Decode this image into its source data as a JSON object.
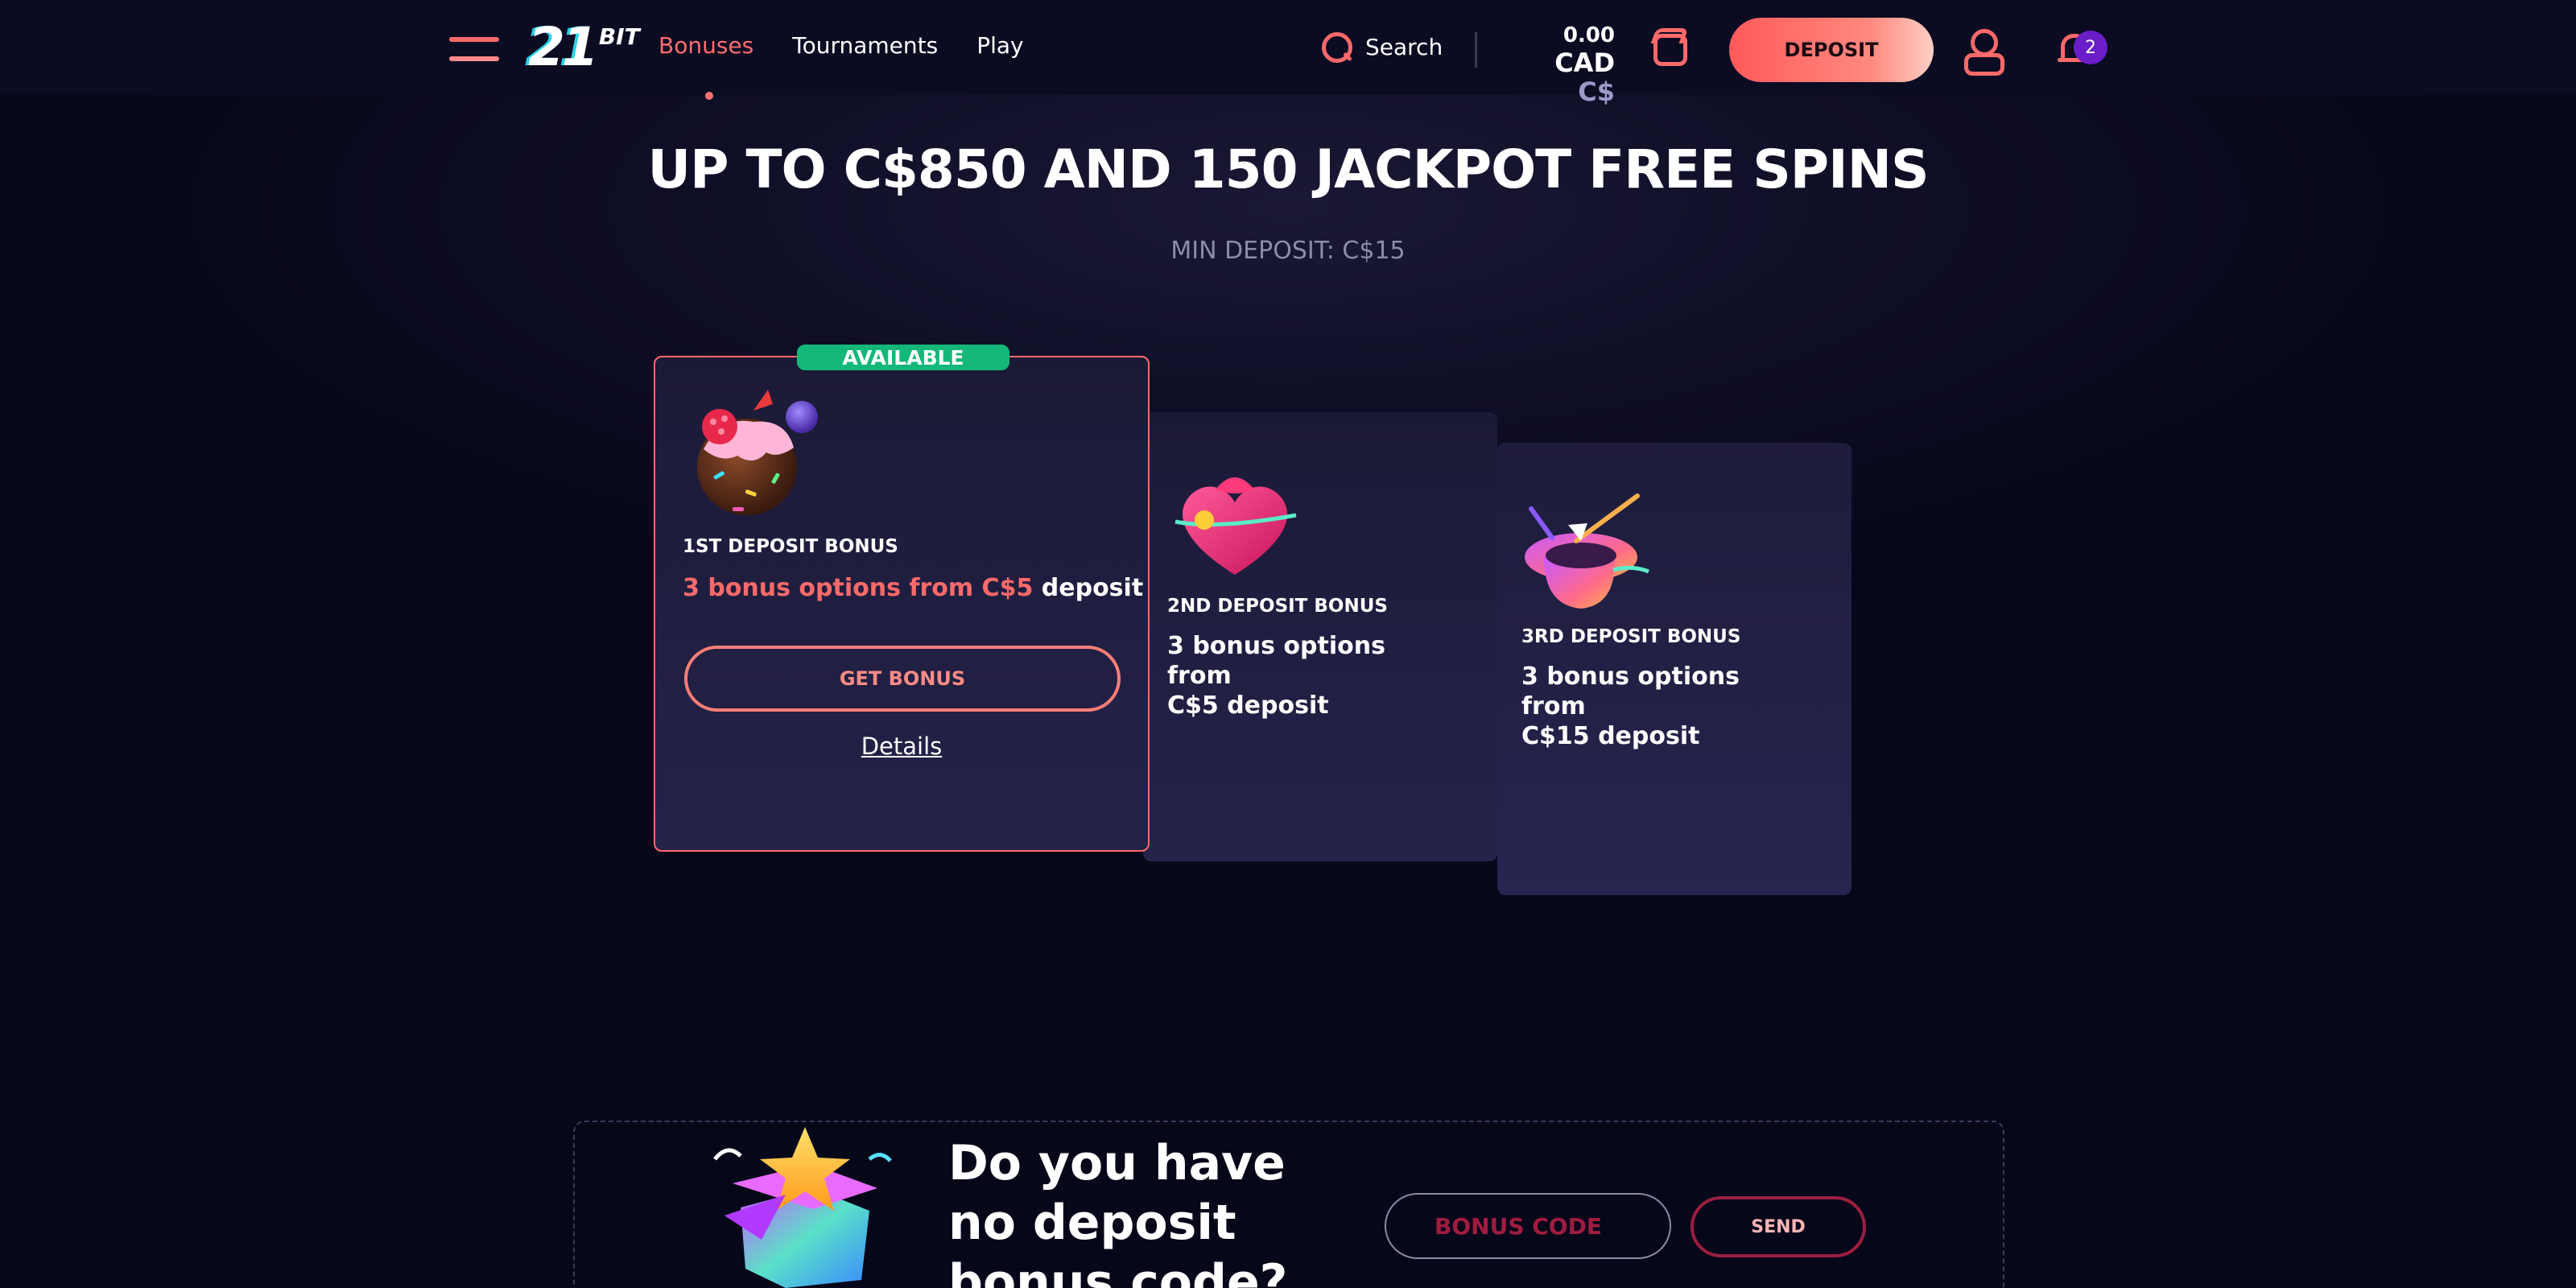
{
  "header": {
    "logo_main": "21",
    "logo_sub": "BIT",
    "nav": [
      {
        "label": "Bonuses",
        "active": true
      },
      {
        "label": "Tournaments",
        "active": false
      },
      {
        "label": "Play",
        "active": false
      }
    ],
    "search_label": "Search",
    "balance_amount": "0.00",
    "balance_currency": "CAD",
    "balance_symbol": "C$",
    "deposit_label": "DEPOSIT",
    "notification_count": "2",
    "icons": [
      "menu-icon",
      "search-icon",
      "wallet-icon",
      "user-icon",
      "bell-icon"
    ],
    "accent_color": "#ff6a6a"
  },
  "hero": {
    "title": "UP TO C$850 AND 150 JACKPOT FREE SPINS",
    "subtitle": "MIN DEPOSIT: C$15"
  },
  "cards": [
    {
      "badge": "AVAILABLE",
      "label": "1ST DEPOSIT BONUS",
      "desc_highlight": "3 bonus options from C$5",
      "desc_rest": " deposit",
      "button": "GET BONUS",
      "details": "Details",
      "icon": "cake-icon"
    },
    {
      "label": "2ND DEPOSIT BONUS",
      "desc_lines": [
        "3 bonus options",
        "from",
        "C$5 deposit"
      ],
      "icon": "gift-heart-icon"
    },
    {
      "label": "3RD DEPOSIT BONUS",
      "desc_lines": [
        "3 bonus options",
        "from",
        "C$15 deposit"
      ],
      "icon": "magic-hat-icon"
    }
  ],
  "bonus_code": {
    "title": "Do you have no deposit bonus code?",
    "placeholder": "BONUS CODE",
    "send": "SEND",
    "icon": "gift-box-icon"
  },
  "colors": {
    "available_badge": "#13b878",
    "card_border": "#ff6a6a",
    "background": "#07071a"
  }
}
